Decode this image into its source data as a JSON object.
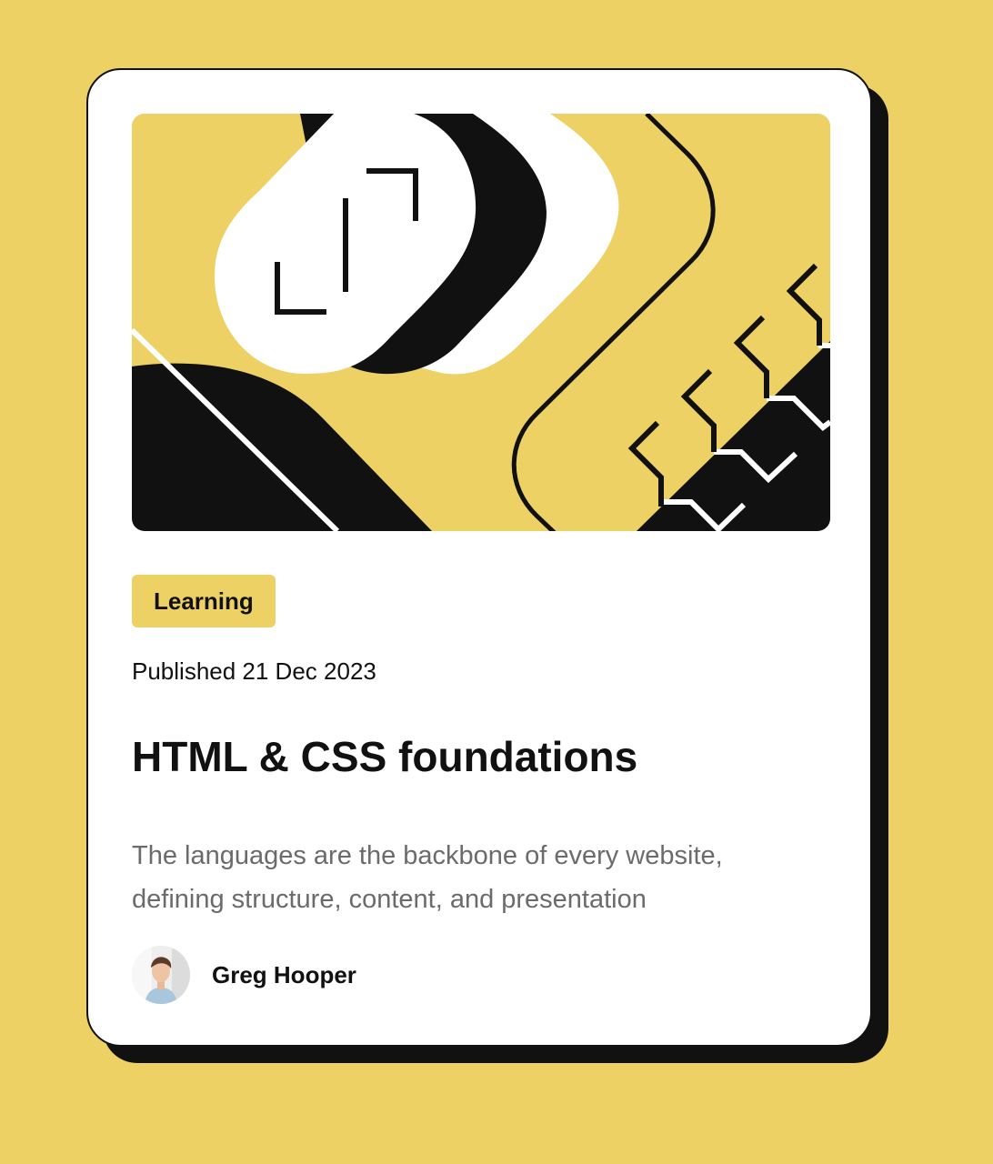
{
  "card": {
    "tag": "Learning",
    "published": "Published 21 Dec 2023",
    "title": "HTML & CSS foundations",
    "description": "The languages are the backbone of every website, defining structure, content, and presentation",
    "author": {
      "name": "Greg Hooper",
      "avatar_icon": "person-avatar-icon"
    }
  },
  "colors": {
    "page_background": "#EDD165",
    "card_background": "#FFFFFF",
    "ink": "#111111",
    "muted_text": "#6B6B6B",
    "accent": "#EDD165"
  }
}
